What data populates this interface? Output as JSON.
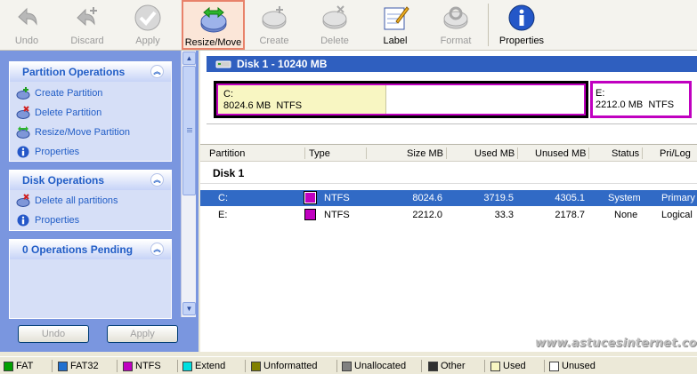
{
  "toolbar": {
    "buttons": [
      {
        "label": "Undo",
        "icon": "undo-icon",
        "enabled": false
      },
      {
        "label": "Discard",
        "icon": "discard-icon",
        "enabled": false
      },
      {
        "label": "Apply",
        "icon": "apply-checkmark-icon",
        "enabled": false
      },
      {
        "label": "Resize/Move",
        "icon": "resize-move-icon",
        "enabled": true,
        "highlighted": true
      },
      {
        "label": "Create",
        "icon": "create-icon",
        "enabled": false
      },
      {
        "label": "Delete",
        "icon": "delete-icon",
        "enabled": false
      },
      {
        "label": "Label",
        "icon": "label-icon",
        "enabled": true
      },
      {
        "label": "Format",
        "icon": "format-icon",
        "enabled": false
      },
      {
        "label": "Properties",
        "icon": "info-icon",
        "enabled": true
      }
    ]
  },
  "sidebar": {
    "partition_ops": {
      "title": "Partition Operations",
      "items": [
        {
          "label": "Create Partition",
          "icon": "create-partition-icon"
        },
        {
          "label": "Delete Partition",
          "icon": "delete-partition-icon"
        },
        {
          "label": "Resize/Move Partition",
          "icon": "resize-partition-icon"
        },
        {
          "label": "Properties",
          "icon": "info-icon"
        }
      ]
    },
    "disk_ops": {
      "title": "Disk Operations",
      "items": [
        {
          "label": "Delete all partitions",
          "icon": "delete-all-icon"
        },
        {
          "label": "Properties",
          "icon": "info-icon"
        }
      ]
    },
    "pending": {
      "title": "0 Operations Pending"
    },
    "undo_label": "Undo",
    "apply_label": "Apply"
  },
  "disk": {
    "title": "Disk 1 - 10240 MB",
    "partitions": [
      {
        "name": "C:",
        "size": "8024.6 MB",
        "fs": "NTFS",
        "used_fraction": 0.46
      },
      {
        "name": "E:",
        "size": "2212.0 MB",
        "fs": "NTFS"
      }
    ]
  },
  "table": {
    "headers": [
      "Partition",
      "Type",
      "Size MB",
      "Used MB",
      "Unused MB",
      "Status",
      "Pri/Log"
    ],
    "group": "Disk 1",
    "rows": [
      {
        "partition": "C:",
        "type": "NTFS",
        "size": "8024.6",
        "used": "3719.5",
        "unused": "4305.1",
        "status": "System",
        "prilog": "Primary",
        "selected": true
      },
      {
        "partition": "E:",
        "type": "NTFS",
        "size": "2212.0",
        "used": "33.3",
        "unused": "2178.7",
        "status": "None",
        "prilog": "Logical",
        "selected": false
      }
    ]
  },
  "watermark": "www.astucesinternet.com",
  "legend": [
    {
      "label": "FAT",
      "color": "#00a000"
    },
    {
      "label": "FAT32",
      "color": "#2070d0"
    },
    {
      "label": "NTFS",
      "color": "#c000c0"
    },
    {
      "label": "Extend",
      "color": "#00e0e0"
    },
    {
      "label": "Unformatted",
      "color": "#808000"
    },
    {
      "label": "Unallocated",
      "color": "#808080"
    },
    {
      "label": "Other",
      "color": "#303030"
    },
    {
      "label": "Used",
      "color": "#f8f6c2"
    },
    {
      "label": "Unused",
      "color": "#ffffff"
    }
  ],
  "colors": {
    "accent": "#2f5fbf",
    "selection": "#316ac5",
    "ntfs": "#c000c0",
    "highlight_border": "#e8826a"
  }
}
